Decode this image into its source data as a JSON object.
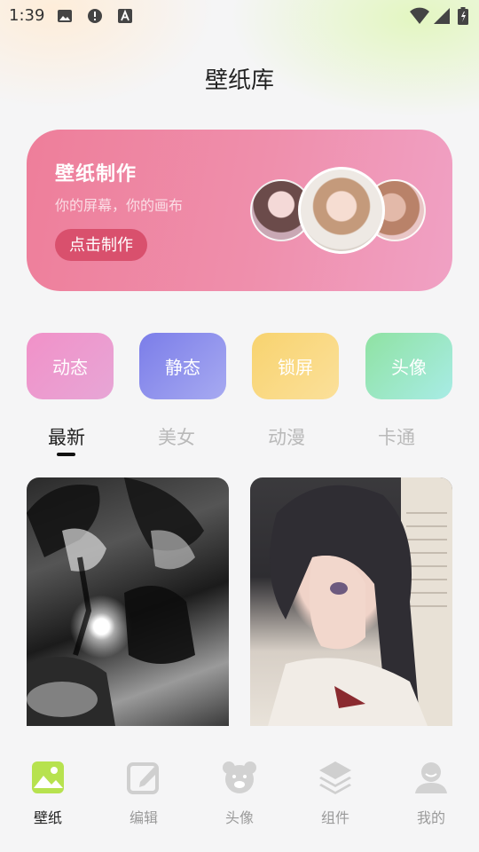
{
  "status_bar": {
    "time": "1:39",
    "icons": [
      "image-icon",
      "alert-icon",
      "text-a-icon"
    ],
    "right_icons": [
      "wifi-icon",
      "signal-icon",
      "battery-icon"
    ]
  },
  "app_title": "壁纸库",
  "banner": {
    "title": "壁纸制作",
    "subtitle": "你的屏幕，你的画布",
    "button_label": "点击制作"
  },
  "categories": [
    {
      "label": "动态",
      "color": "#f191c8"
    },
    {
      "label": "静态",
      "color": "#7b7de9"
    },
    {
      "label": "锁屏",
      "color": "#f8d36f"
    },
    {
      "label": "头像",
      "color": "#8fe2a2"
    }
  ],
  "tabs": [
    {
      "label": "最新",
      "active": true
    },
    {
      "label": "美女",
      "active": false
    },
    {
      "label": "动漫",
      "active": false
    },
    {
      "label": "卡通",
      "active": false
    }
  ],
  "bottom_nav": [
    {
      "label": "壁纸",
      "icon": "wallpaper-icon",
      "active": true
    },
    {
      "label": "编辑",
      "icon": "edit-icon",
      "active": false
    },
    {
      "label": "头像",
      "icon": "bear-avatar-icon",
      "active": false
    },
    {
      "label": "组件",
      "icon": "layers-icon",
      "active": false
    },
    {
      "label": "我的",
      "icon": "user-icon",
      "active": false
    }
  ],
  "colors": {
    "accent_active": "#b7e24f",
    "banner": "#ee7e9a",
    "banner_button": "#d9506d",
    "inactive": "#9a9a9a"
  }
}
